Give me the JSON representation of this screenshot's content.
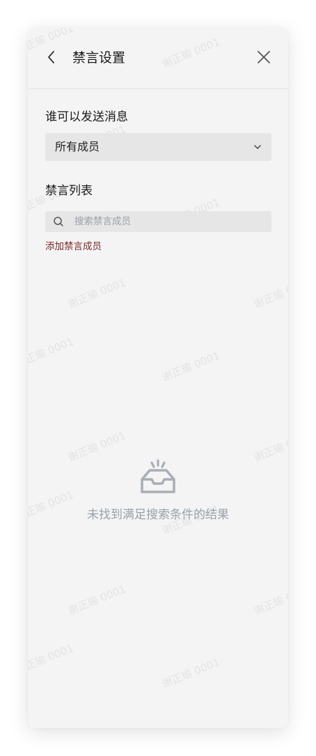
{
  "header": {
    "title": "禁言设置",
    "back_icon": "chevron-left-icon",
    "close_icon": "close-icon"
  },
  "send_permission": {
    "label": "谁可以发送消息",
    "selected": "所有成员",
    "dropdown_icon": "chevron-down-icon"
  },
  "mute_list": {
    "label": "禁言列表",
    "search_placeholder": "搜索禁言成员",
    "search_icon": "search-icon",
    "add_link": "添加禁言成员"
  },
  "empty_state": {
    "icon": "empty-inbox-icon",
    "text": "未找到满足搜索条件的结果"
  },
  "watermark": {
    "text": "谢正瑜 0001"
  },
  "colors": {
    "panel_bg": "#f4f4f4",
    "field_bg": "#e6e6e6",
    "link": "#7b2a28",
    "muted_text": "#9aa0aa",
    "icon_gray": "#a9adb5"
  }
}
